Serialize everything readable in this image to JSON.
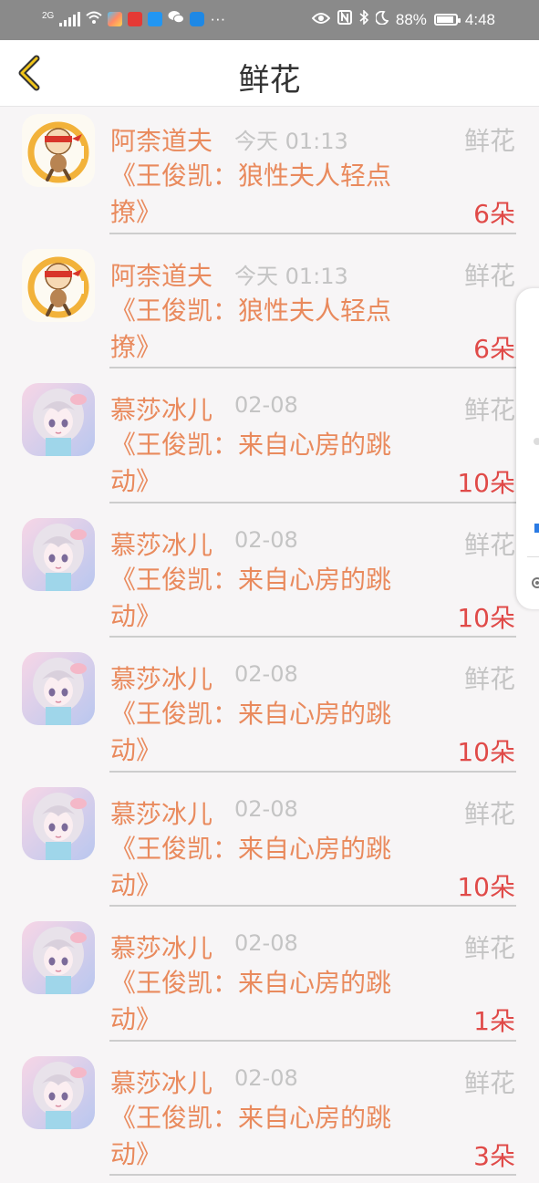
{
  "status_bar": {
    "network": "2G",
    "battery": "88%",
    "time": "4:48"
  },
  "header": {
    "title": "鲜花"
  },
  "items": [
    {
      "name": "阿柰道夫",
      "time": "今天 01:13",
      "type": "鲜花",
      "work": "《王俊凯：狼性夫人轻点撩》",
      "count": "6朵",
      "avatar": "cartoon-avatar"
    },
    {
      "name": "阿柰道夫",
      "time": "今天 01:13",
      "type": "鲜花",
      "work": "《王俊凯：狼性夫人轻点撩》",
      "count": "6朵",
      "avatar": "cartoon-avatar"
    },
    {
      "name": "慕莎冰儿",
      "time": "02-08",
      "type": "鲜花",
      "work": "《王俊凯：来自心房的跳动》",
      "count": "10朵",
      "avatar": "anime-girl-avatar"
    },
    {
      "name": "慕莎冰儿",
      "time": "02-08",
      "type": "鲜花",
      "work": "《王俊凯：来自心房的跳动》",
      "count": "10朵",
      "avatar": "anime-girl-avatar"
    },
    {
      "name": "慕莎冰儿",
      "time": "02-08",
      "type": "鲜花",
      "work": "《王俊凯：来自心房的跳动》",
      "count": "10朵",
      "avatar": "anime-girl-avatar"
    },
    {
      "name": "慕莎冰儿",
      "time": "02-08",
      "type": "鲜花",
      "work": "《王俊凯：来自心房的跳动》",
      "count": "10朵",
      "avatar": "anime-girl-avatar"
    },
    {
      "name": "慕莎冰儿",
      "time": "02-08",
      "type": "鲜花",
      "work": "《王俊凯：来自心房的跳动》",
      "count": "1朵",
      "avatar": "anime-girl-avatar"
    },
    {
      "name": "慕莎冰儿",
      "time": "02-08",
      "type": "鲜花",
      "work": "《王俊凯：来自心房的跳动》",
      "count": "3朵",
      "avatar": "anime-girl-avatar"
    }
  ]
}
